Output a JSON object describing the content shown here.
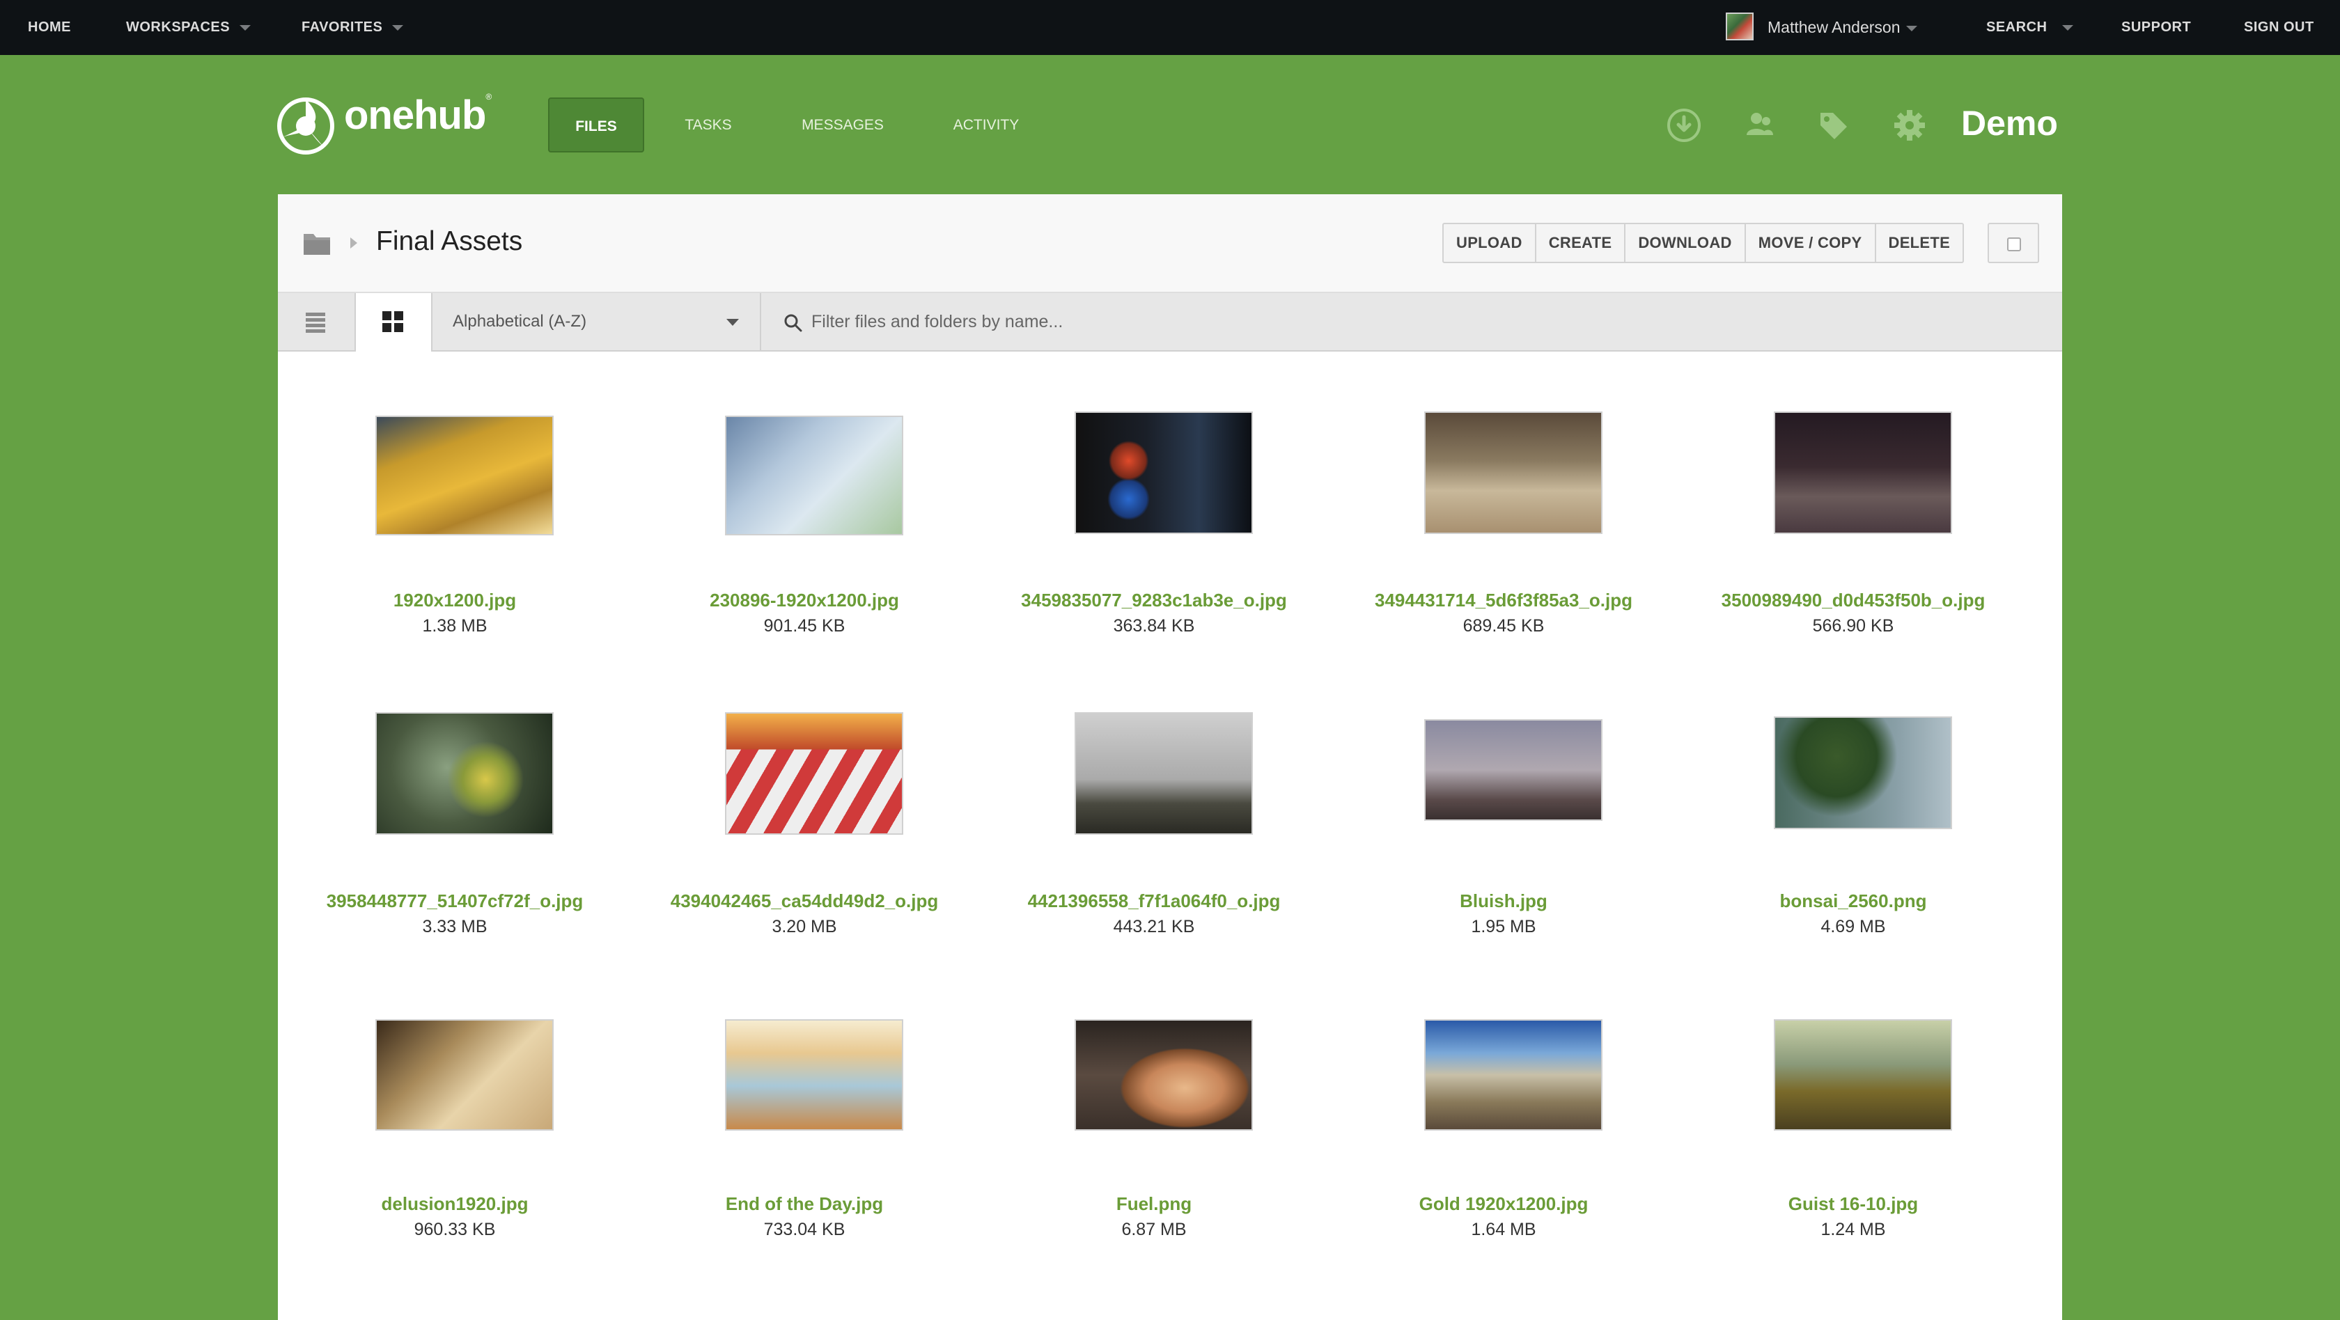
{
  "topnav": {
    "home": "HOME",
    "workspaces": "WORKSPACES",
    "favorites": "FAVORITES",
    "user_name": "Matthew Anderson",
    "search": "SEARCH",
    "support": "SUPPORT",
    "sign_out": "SIGN OUT"
  },
  "header": {
    "logo_text": "onehub",
    "tabs": [
      "FILES",
      "TASKS",
      "MESSAGES",
      "ACTIVITY"
    ],
    "active_tab": "FILES",
    "workspace_name": "Demo",
    "icons": [
      "download-icon",
      "members-icon",
      "tag-icon",
      "gear-icon"
    ]
  },
  "folder": {
    "title": "Final Assets",
    "actions": [
      "UPLOAD",
      "CREATE",
      "DOWNLOAD",
      "MOVE / COPY",
      "DELETE"
    ]
  },
  "toolbar": {
    "sort_value": "Alphabetical (A-Z)",
    "filter_placeholder": "Filter files and folders by name..."
  },
  "files": [
    {
      "name": "1920x1200.jpg",
      "size": "1.38 MB"
    },
    {
      "name": "230896-1920x1200.jpg",
      "size": "901.45 KB"
    },
    {
      "name": "3459835077_9283c1ab3e_o.jpg",
      "size": "363.84 KB"
    },
    {
      "name": "3494431714_5d6f3f85a3_o.jpg",
      "size": "689.45 KB"
    },
    {
      "name": "3500989490_d0d453f50b_o.jpg",
      "size": "566.90 KB"
    },
    {
      "name": "3958448777_51407cf72f_o.jpg",
      "size": "3.33 MB"
    },
    {
      "name": "4394042465_ca54dd49d2_o.jpg",
      "size": "3.20 MB"
    },
    {
      "name": "4421396558_f7f1a064f0_o.jpg",
      "size": "443.21 KB"
    },
    {
      "name": "Bluish.jpg",
      "size": "1.95 MB"
    },
    {
      "name": "bonsai_2560.png",
      "size": "4.69 MB"
    },
    {
      "name": "delusion1920.jpg",
      "size": "960.33 KB"
    },
    {
      "name": "End of the Day.jpg",
      "size": "733.04 KB"
    },
    {
      "name": "Fuel.png",
      "size": "6.87 MB"
    },
    {
      "name": "Gold 1920x1200.jpg",
      "size": "1.64 MB"
    },
    {
      "name": "Guist 16-10.jpg",
      "size": "1.24 MB"
    }
  ],
  "colors": {
    "brand_green": "#65a144",
    "link_green": "#6a9c37",
    "topbar": "#0e1215"
  }
}
